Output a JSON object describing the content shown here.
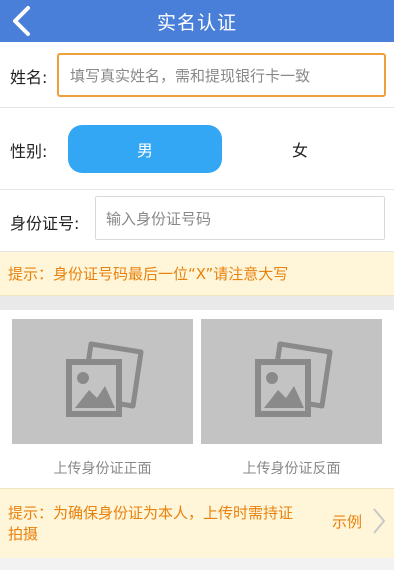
{
  "header": {
    "title": "实名认证",
    "back_icon": "chevron-left-icon"
  },
  "form": {
    "name_label": "姓名:",
    "name_placeholder": "填写真实姓名，需和提现银行卡一致",
    "gender_label": "性别:",
    "gender_male": "男",
    "gender_female": "女",
    "gender_selected": "男",
    "id_label": "身份证号:",
    "id_placeholder": "输入身份证号码"
  },
  "tip_id": "提示：身份证号码最后一位“X”请注意大写",
  "uploads": [
    {
      "label": "上传身份证正面",
      "icon": "photo-placeholder-icon"
    },
    {
      "label": "上传身份证反面",
      "icon": "photo-placeholder-icon"
    }
  ],
  "tip_photo": {
    "text": "提示：为确保身份证为本人，上传时需持证拍摄",
    "example_label": "示例",
    "arrow_icon": "chevron-right-icon"
  },
  "colors": {
    "header": "#4a7fd9",
    "accent_blue": "#33a6f4",
    "tip_text": "#e8820e",
    "tip_bg": "#fff5d8",
    "input_focus": "#f0a03a"
  }
}
